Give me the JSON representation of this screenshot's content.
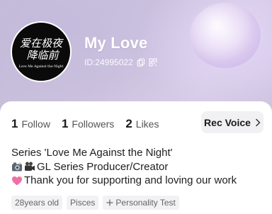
{
  "profile": {
    "username": "My Love",
    "id_text": "ID:24995022",
    "avatar_logo_lines": [
      "爱在极夜",
      "降临前"
    ],
    "avatar_subtitle": "Love Me Against the Night"
  },
  "stats": [
    {
      "count": "1",
      "label": "Follow"
    },
    {
      "count": "1",
      "label": "Followers"
    },
    {
      "count": "2",
      "label": "Likes"
    }
  ],
  "rec_voice": {
    "label": "Rec Voice"
  },
  "bio": {
    "line1": "Series 'Love Me Against the Night'",
    "line2": "GL Series Producer/Creator",
    "line3": "Thank you for supporting and loving our work"
  },
  "tags": {
    "age": "28years old",
    "zodiac": "Pisces",
    "personality": "Personality Test"
  },
  "icons": {
    "copy": "copy-icon",
    "qr": "qr-code-icon",
    "chevron": "chevron-right-icon",
    "camera": "camera-flash-emoji",
    "movie_camera": "movie-camera-emoji",
    "heart": "sparkling-heart-emoji",
    "plus": "plus-icon"
  },
  "colors": {
    "header_bg": "#cdc3df",
    "text_primary": "#1e1e1e",
    "tag_bg": "#f2f2f4"
  }
}
